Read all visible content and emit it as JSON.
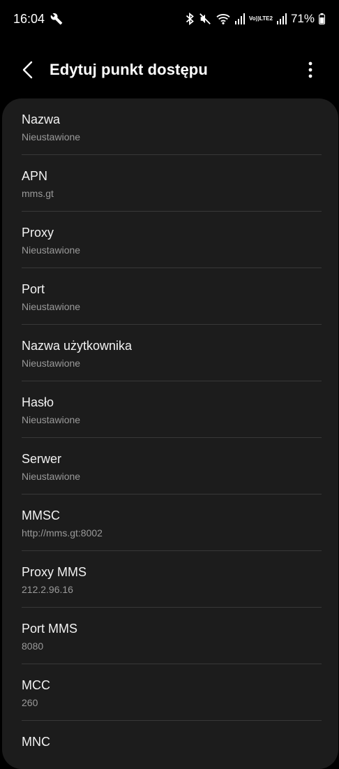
{
  "status_bar": {
    "time": "16:04",
    "battery": "71%",
    "network_label_top": "Vo))",
    "network_label_bottom": "LTE2"
  },
  "header": {
    "title": "Edytuj punkt dostępu"
  },
  "fields": [
    {
      "label": "Nazwa",
      "value": "Nieustawione"
    },
    {
      "label": "APN",
      "value": "mms.gt"
    },
    {
      "label": "Proxy",
      "value": "Nieustawione"
    },
    {
      "label": "Port",
      "value": "Nieustawione"
    },
    {
      "label": "Nazwa użytkownika",
      "value": "Nieustawione"
    },
    {
      "label": "Hasło",
      "value": "Nieustawione"
    },
    {
      "label": "Serwer",
      "value": "Nieustawione"
    },
    {
      "label": "MMSC",
      "value": "http://mms.gt:8002"
    },
    {
      "label": "Proxy MMS",
      "value": "212.2.96.16"
    },
    {
      "label": "Port MMS",
      "value": "8080"
    },
    {
      "label": "MCC",
      "value": "260"
    },
    {
      "label": "MNC",
      "value": ""
    }
  ],
  "icons": {
    "wrench": "wrench-icon",
    "bluetooth": "bluetooth-icon",
    "mute": "mute-icon",
    "wifi": "wifi-icon",
    "signal": "signal-icon",
    "battery": "battery-icon",
    "back": "back-arrow-icon",
    "more": "more-options-icon"
  },
  "colors": {
    "background": "#000000",
    "card": "#1c1c1c",
    "label": "#f2f2f2",
    "value": "#9a9a9a",
    "divider": "#383838"
  }
}
